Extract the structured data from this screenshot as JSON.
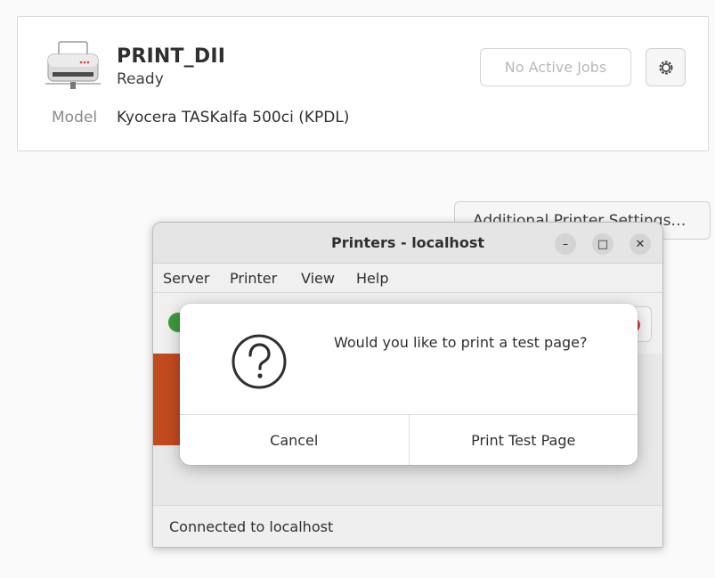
{
  "printer_panel": {
    "name": "PRINT_DII",
    "status": "Ready",
    "model_label": "Model",
    "model_value": "Kyocera TASKalfa 500ci (KPDL)",
    "jobs_button": "No Active Jobs",
    "settings_icon": "gear-icon",
    "printer_icon": "printer-icon",
    "additional_settings_button": "Additional Printer Settings…"
  },
  "window": {
    "title": "Printers - localhost",
    "controls": {
      "minimize": "–",
      "maximize": "□",
      "close": "✕"
    },
    "menu": [
      "Server",
      "Printer",
      "View",
      "Help"
    ],
    "status_bar": "Connected to localhost"
  },
  "dialog": {
    "icon": "question-icon",
    "message": "Would you like to print a test page?",
    "cancel_label": "Cancel",
    "confirm_label": "Print Test Page"
  },
  "colors": {
    "accent_orange": "#c14a1f",
    "green": "#3e9b3e",
    "red": "#e04040"
  }
}
